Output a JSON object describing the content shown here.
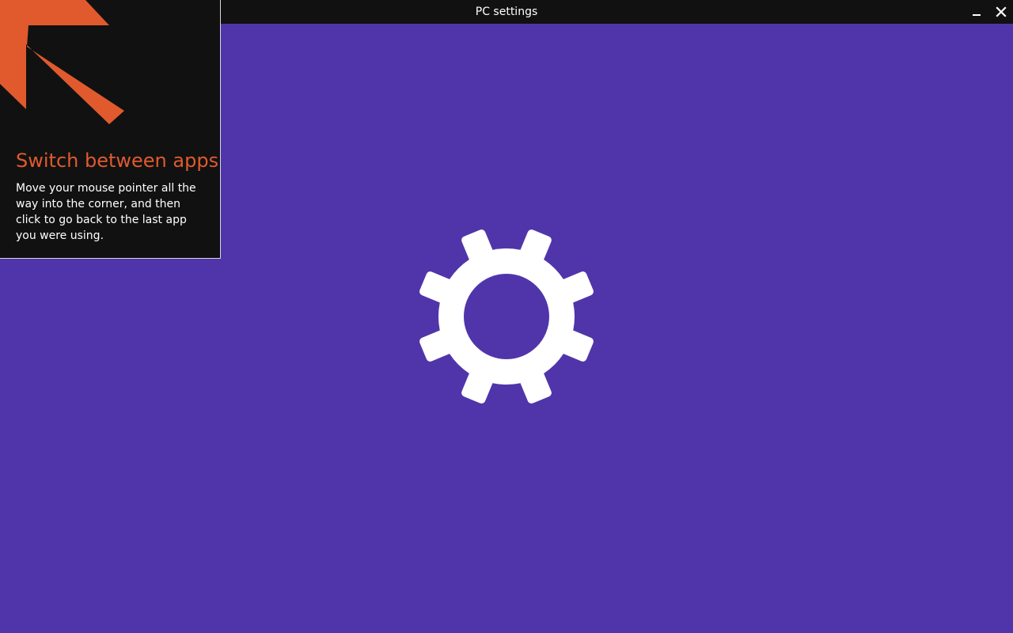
{
  "window": {
    "title": "PC settings",
    "minimize_icon": "minimize-icon",
    "close_icon": "close-icon"
  },
  "splash": {
    "icon": "gear-icon",
    "background_color": "#5035aa",
    "icon_color": "#ffffff"
  },
  "tip": {
    "icon": "arrow-up-left-icon",
    "title": "Switch between apps",
    "body": "Move your mouse pointer all the way into the corner, and then click to go back to the last app you were using.",
    "accent_color": "#e05a2e",
    "background_color": "#111111"
  }
}
